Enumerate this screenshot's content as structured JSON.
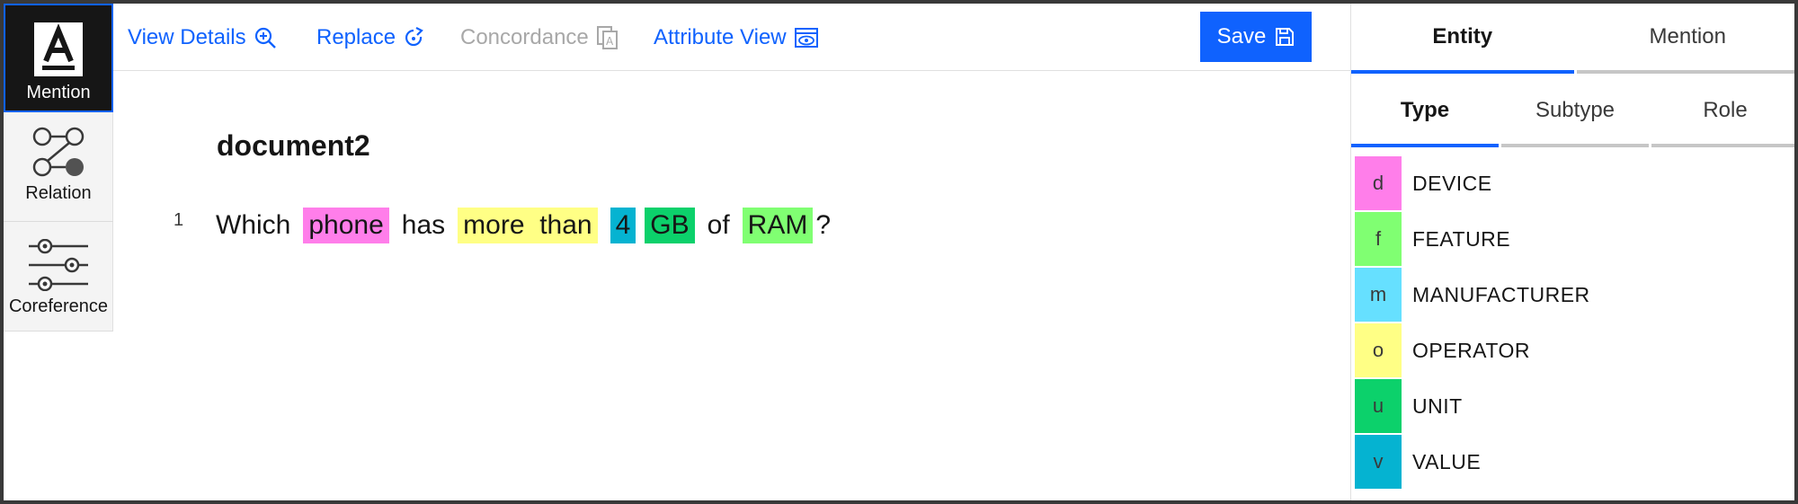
{
  "tools": [
    {
      "label": "Mention",
      "icon": "mention-icon"
    },
    {
      "label": "Relation",
      "icon": "relation-icon"
    },
    {
      "label": "Coreference",
      "icon": "coreference-icon"
    }
  ],
  "toolbar": {
    "view_details": "View Details",
    "replace": "Replace",
    "concordance": "Concordance",
    "attribute_view": "Attribute View",
    "save": "Save"
  },
  "document": {
    "title": "document2",
    "line_number": "1",
    "tokens": {
      "t1": "Which",
      "t2": "phone",
      "t3": "has",
      "t4": "more  than",
      "t5": "4",
      "t6": "GB",
      "t7": "of",
      "t8": "RAM",
      "t9": "?"
    }
  },
  "panel": {
    "tabs": [
      "Entity",
      "Mention"
    ],
    "subtabs": [
      "Type",
      "Subtype",
      "Role"
    ],
    "types": [
      {
        "key": "d",
        "name": "DEVICE",
        "color": "#ff7eea"
      },
      {
        "key": "f",
        "name": "FEATURE",
        "color": "#80ff72"
      },
      {
        "key": "m",
        "name": "MANUFACTURER",
        "color": "#66e0ff"
      },
      {
        "key": "o",
        "name": "OPERATOR",
        "color": "#ffff85"
      },
      {
        "key": "u",
        "name": "UNIT",
        "color": "#0cd16b"
      },
      {
        "key": "v",
        "name": "VALUE",
        "color": "#05b3d1"
      }
    ]
  },
  "colors": {
    "accent": "#0f62fe",
    "device": "#ff7eea",
    "operator": "#ffff85",
    "value": "#05b3d1",
    "unit": "#0cd16b",
    "feature": "#80ff72"
  }
}
